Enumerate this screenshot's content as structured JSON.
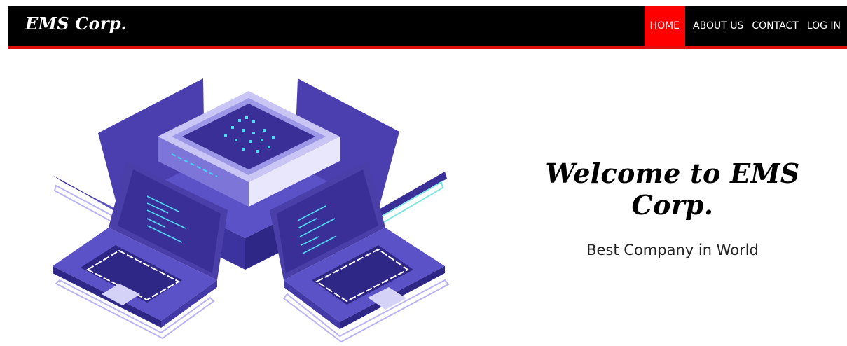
{
  "navbar": {
    "brand": "EMS Corp.",
    "links": [
      {
        "label": "HOME",
        "active": true
      },
      {
        "label": "ABOUT US",
        "active": false
      },
      {
        "label": "CONTACT",
        "active": false
      },
      {
        "label": "LOG IN",
        "active": false
      }
    ],
    "colors": {
      "background": "#000000",
      "active": "#ff0000",
      "underline": "#e10e0e"
    }
  },
  "hero": {
    "title": "Welcome to EMS Corp.",
    "subtitle": "Best Company in World",
    "illustration": "server-with-laptops-illustration"
  }
}
